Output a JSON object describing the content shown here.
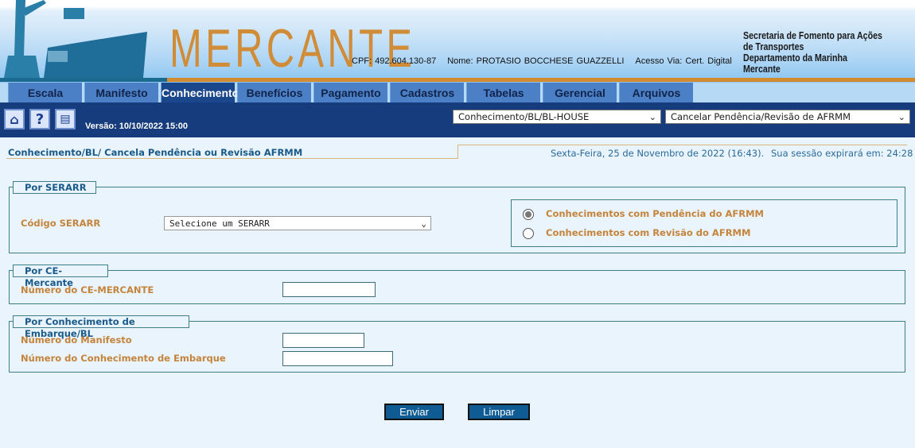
{
  "header": {
    "logo": "MERCANTE",
    "cpf": "CPF: 492.604.130-87",
    "nome": "Nome: PROTASIO BOCCHESE GUAZZELLI",
    "acesso": "Acesso Via: Cert. Digital",
    "org_line1": "Secretaria de Fomento para Ações de Transportes",
    "org_line2": "Departamento da Marinha Mercante"
  },
  "tabs": [
    {
      "label": "Escala"
    },
    {
      "label": "Manifesto"
    },
    {
      "label": "Conhecimento",
      "active": true
    },
    {
      "label": "Benefícios"
    },
    {
      "label": "Pagamento"
    },
    {
      "label": "Cadastros"
    },
    {
      "label": "Tabelas"
    },
    {
      "label": "Gerencial"
    },
    {
      "label": "Arquivos"
    }
  ],
  "toolbar": {
    "version": "Versão: 10/10/2022 15:00",
    "module_select": "Conhecimento/BL/BL-HOUSE",
    "function_select": "Cancelar Pendência/Revisão de AFRMM",
    "icons": [
      "home-icon",
      "help-icon",
      "print-icon"
    ]
  },
  "page": {
    "breadcrumb": "Conhecimento/BL/ Cancela Pendência ou Revisão AFRMM",
    "date": "Sexta-Feira, 25 de Novembro de 2022 (16:43).",
    "session": "Sua sessão expirará em: 24:28"
  },
  "serarr": {
    "legend": "Por SERARR",
    "label": "Código SERARR",
    "select_value": "Selecione um SERARR",
    "radio1": "Conhecimentos com Pendência do AFRMM",
    "radio2": "Conhecimentos com Revisão do AFRMM"
  },
  "ce": {
    "legend": "Por CE-Mercante",
    "label": "Número do CE-MERCANTE",
    "value": ""
  },
  "bl": {
    "legend": "Por Conhecimento de Embarque/BL",
    "manifesto_label": "Número do Manifesto",
    "conhecimento_label": "Número do Conhecimento de Embarque"
  },
  "buttons": {
    "enviar": "Enviar",
    "limpar": "Limpar"
  }
}
